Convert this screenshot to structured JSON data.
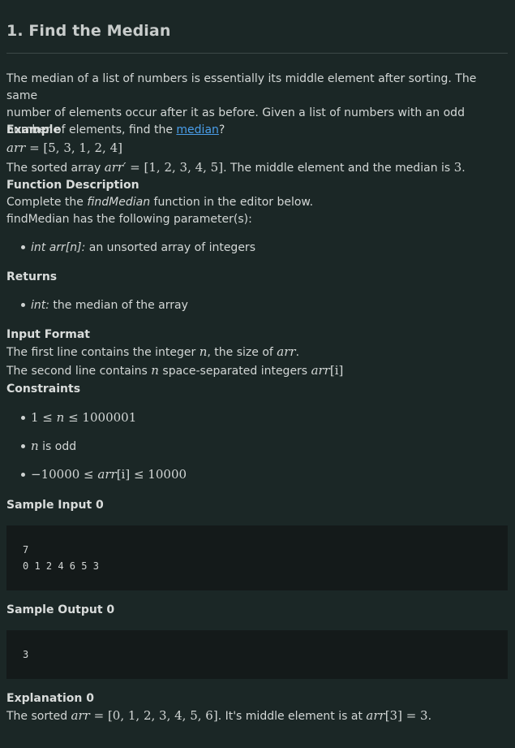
{
  "problem": {
    "title": "1. Find the Median",
    "intro_1": "The median of a list of numbers is essentially its middle element after sorting. The same",
    "intro_2": "number of elements occur after it as before. Given a list of numbers with an odd",
    "intro_3a": "number of elements, find the ",
    "intro_link": "median",
    "intro_3b": "?"
  },
  "example": {
    "heading": "Example",
    "arr_var": "arr",
    "arr_eq": " = [5, 3, 1, 2, 4]",
    "sorted_a": "The sorted array ",
    "sorted_var": "arr′",
    "sorted_eq": " = [1, 2, 3, 4, 5]",
    "sorted_b": ". The middle element and the median is ",
    "sorted_val": "3",
    "sorted_c": "."
  },
  "function_description": {
    "heading": "Function Description",
    "line1_a": "Complete the ",
    "line1_fn": "findMedian",
    "line1_b": " function in the editor below.",
    "line2": "findMedian has the following parameter(s):",
    "param_type": "int arr[n]:",
    "param_desc": " an unsorted array of integers"
  },
  "returns": {
    "heading": "Returns",
    "type": "int:",
    "desc": " the median of the array"
  },
  "input_format": {
    "heading": "Input Format",
    "line1_a": "The first line contains the integer ",
    "line1_n": "n",
    "line1_b": ", the size of ",
    "line1_arr": "arr",
    "line1_c": ".",
    "line2_a": "The second line contains ",
    "line2_n": "n",
    "line2_b": " space-separated integers ",
    "line2_arr": "arr",
    "line2_idx": "[i]"
  },
  "constraints": {
    "heading": "Constraints",
    "c1_a": "1 ≤ ",
    "c1_n": "n",
    "c1_b": " ≤ 1000001",
    "c2_n": "n",
    "c2_b": " is odd",
    "c3_a": "−10000 ≤ ",
    "c3_arr": "arr",
    "c3_idx": "[i]",
    "c3_b": " ≤ 10000"
  },
  "sample_input": {
    "heading": "Sample Input 0",
    "lines": [
      "7",
      "0 1 2 4 6 5 3"
    ]
  },
  "sample_output": {
    "heading": "Sample Output 0",
    "lines": [
      "3"
    ]
  },
  "explanation": {
    "heading": "Explanation 0",
    "a": "The sorted ",
    "arr": "arr",
    "eq": " = [0, 1, 2, 3, 4, 5, 6]",
    "b": ". It's middle element is at ",
    "arr2": "arr",
    "eq2": "[3] = 3",
    "c": "."
  }
}
